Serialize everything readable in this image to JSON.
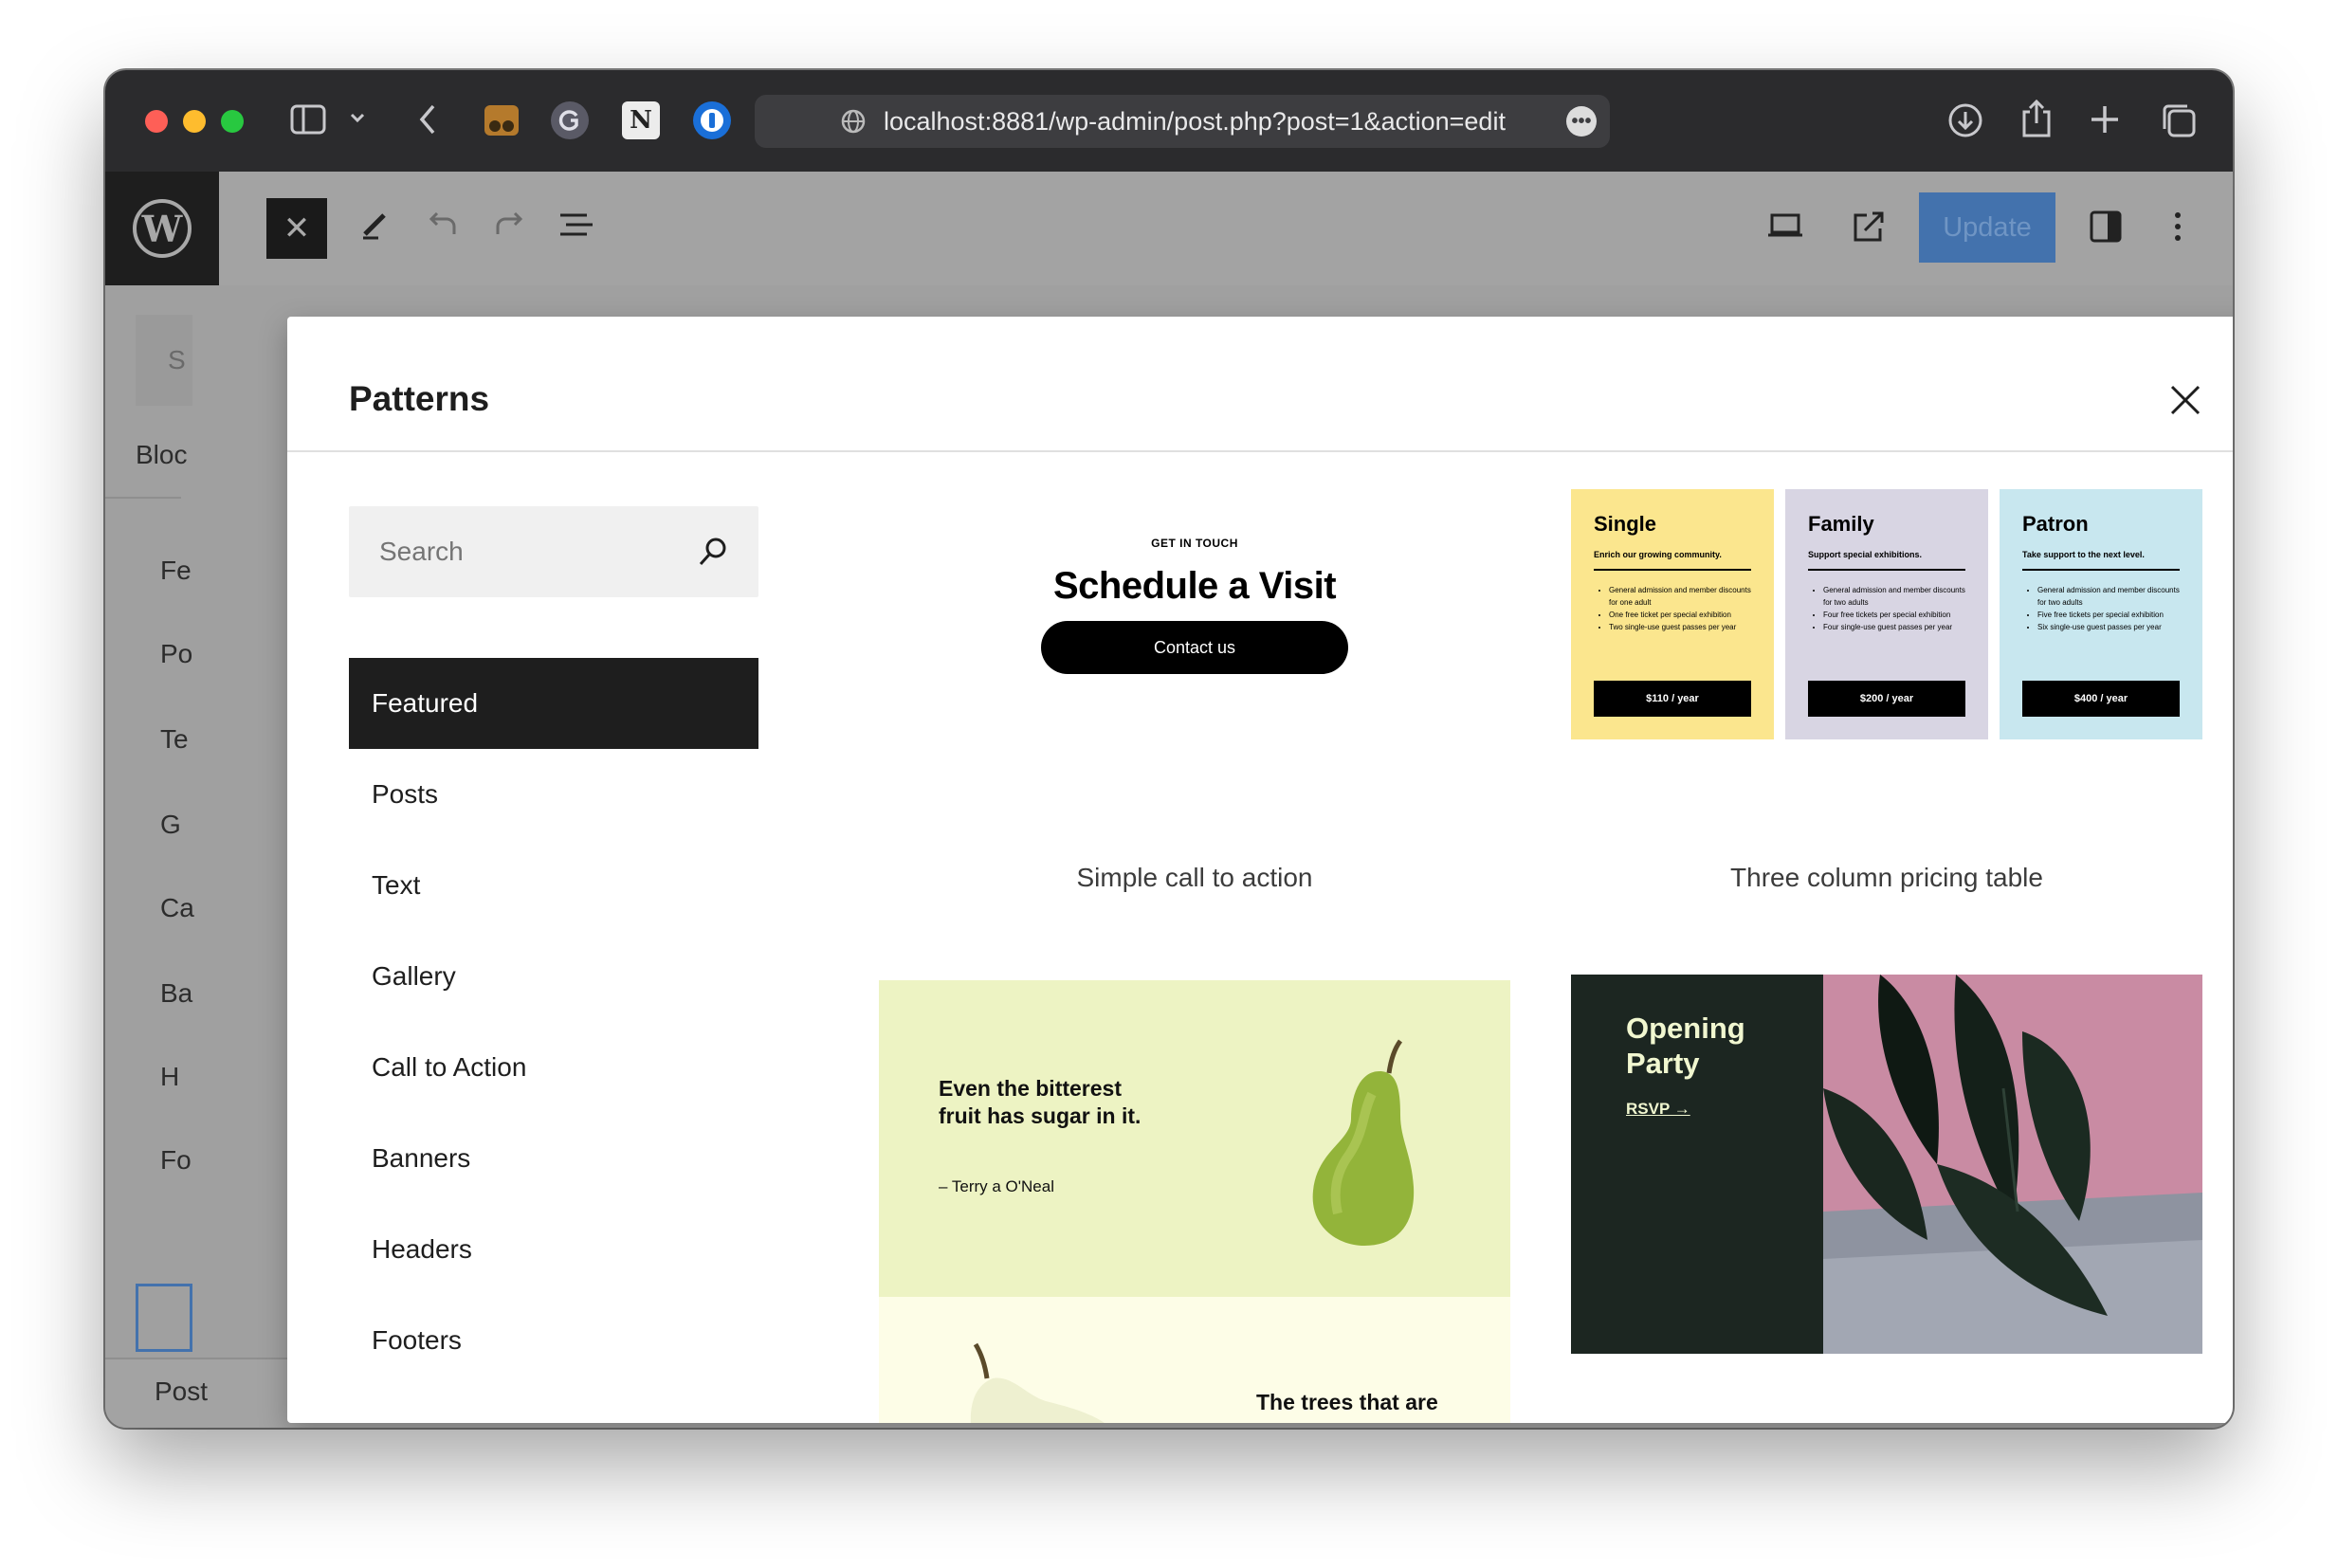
{
  "browser": {
    "url": "localhost:8881/wp-admin/post.php?post=1&action=edit"
  },
  "editor": {
    "update_label": "Update",
    "sidebar_fragments": [
      "S",
      "Bloc",
      "Fe",
      "Po",
      "Te",
      "G",
      "Ca",
      "Ba",
      "H",
      "Fo"
    ],
    "footer_label": "Post"
  },
  "modal": {
    "title": "Patterns",
    "search_placeholder": "Search",
    "categories": [
      {
        "label": "Featured",
        "active": true
      },
      {
        "label": "Posts"
      },
      {
        "label": "Text"
      },
      {
        "label": "Gallery"
      },
      {
        "label": "Call to Action"
      },
      {
        "label": "Banners"
      },
      {
        "label": "Headers"
      },
      {
        "label": "Footers"
      }
    ],
    "patterns": {
      "cta": {
        "label": "Simple call to action",
        "eyebrow": "GET IN TOUCH",
        "headline": "Schedule a Visit",
        "button": "Contact us"
      },
      "pricing": {
        "label": "Three column pricing table",
        "columns": [
          {
            "title": "Single",
            "subtitle": "Enrich our growing community.",
            "features": [
              "General admission and member discounts for one adult",
              "One free ticket per special exhibition",
              "Two single-use guest passes per year"
            ],
            "price": "$110 / year",
            "color": "#fbe68e"
          },
          {
            "title": "Family",
            "subtitle": "Support special exhibitions.",
            "features": [
              "General admission and member discounts for two adults",
              "Four free tickets per special exhibition",
              "Four single-use guest passes per year"
            ],
            "price": "$200 / year",
            "color": "#d8d5e3"
          },
          {
            "title": "Patron",
            "subtitle": "Take support to the next level.",
            "features": [
              "General admission and member discounts for two adults",
              "Five free tickets per special exhibition",
              "Six single-use guest passes per year"
            ],
            "price": "$400 / year",
            "color": "#c8e7ef"
          }
        ]
      },
      "quote": {
        "text": "Even the bitterest fruit has sugar in it.",
        "cite": "– Terry a O'Neal",
        "next_text": "The trees that are"
      },
      "party": {
        "title": "Opening Party",
        "rsvp": "RSVP →"
      }
    }
  }
}
